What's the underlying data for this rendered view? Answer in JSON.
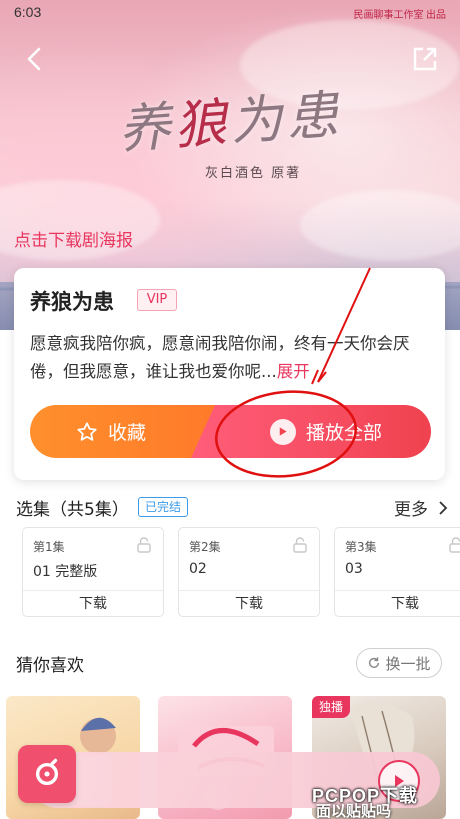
{
  "status_bar": {
    "time": "6:03",
    "right_text": "民画聊事工作室 出品"
  },
  "cover": {
    "title_left": "养",
    "title_mid": "狼",
    "title_right": "为患",
    "author": "灰白酒色 原著",
    "download_poster": "点击下载剧海报"
  },
  "album": {
    "title": "养狼为患",
    "badge": "VIP",
    "description": "愿意疯我陪你疯，愿意闹我陪你闹，终有一天你会厌倦，但我愿意，谁让我也爱你呢...",
    "expand_label": "展开",
    "collect_label": "收藏",
    "play_all_label": "播放全部"
  },
  "episodes": {
    "header": "选集（共5集）",
    "status": "已完结",
    "more_label": "更多",
    "items": [
      {
        "number": "第1集",
        "name": "01 完整版",
        "download": "下载"
      },
      {
        "number": "第2集",
        "name": "02",
        "download": "下载"
      },
      {
        "number": "第3集",
        "name": "03",
        "download": "下载"
      }
    ]
  },
  "recommend": {
    "title": "猜你喜欢",
    "refresh_label": "换一批",
    "items": [
      {
        "badge": ""
      },
      {
        "badge": ""
      },
      {
        "badge": "独播"
      }
    ]
  },
  "watermark": {
    "brand": "PCPOP下载",
    "sub": "面以贴贴吗"
  },
  "colors": {
    "accent": "#e8365e",
    "orange": "#ff8f2c",
    "blue": "#3c9be8"
  }
}
